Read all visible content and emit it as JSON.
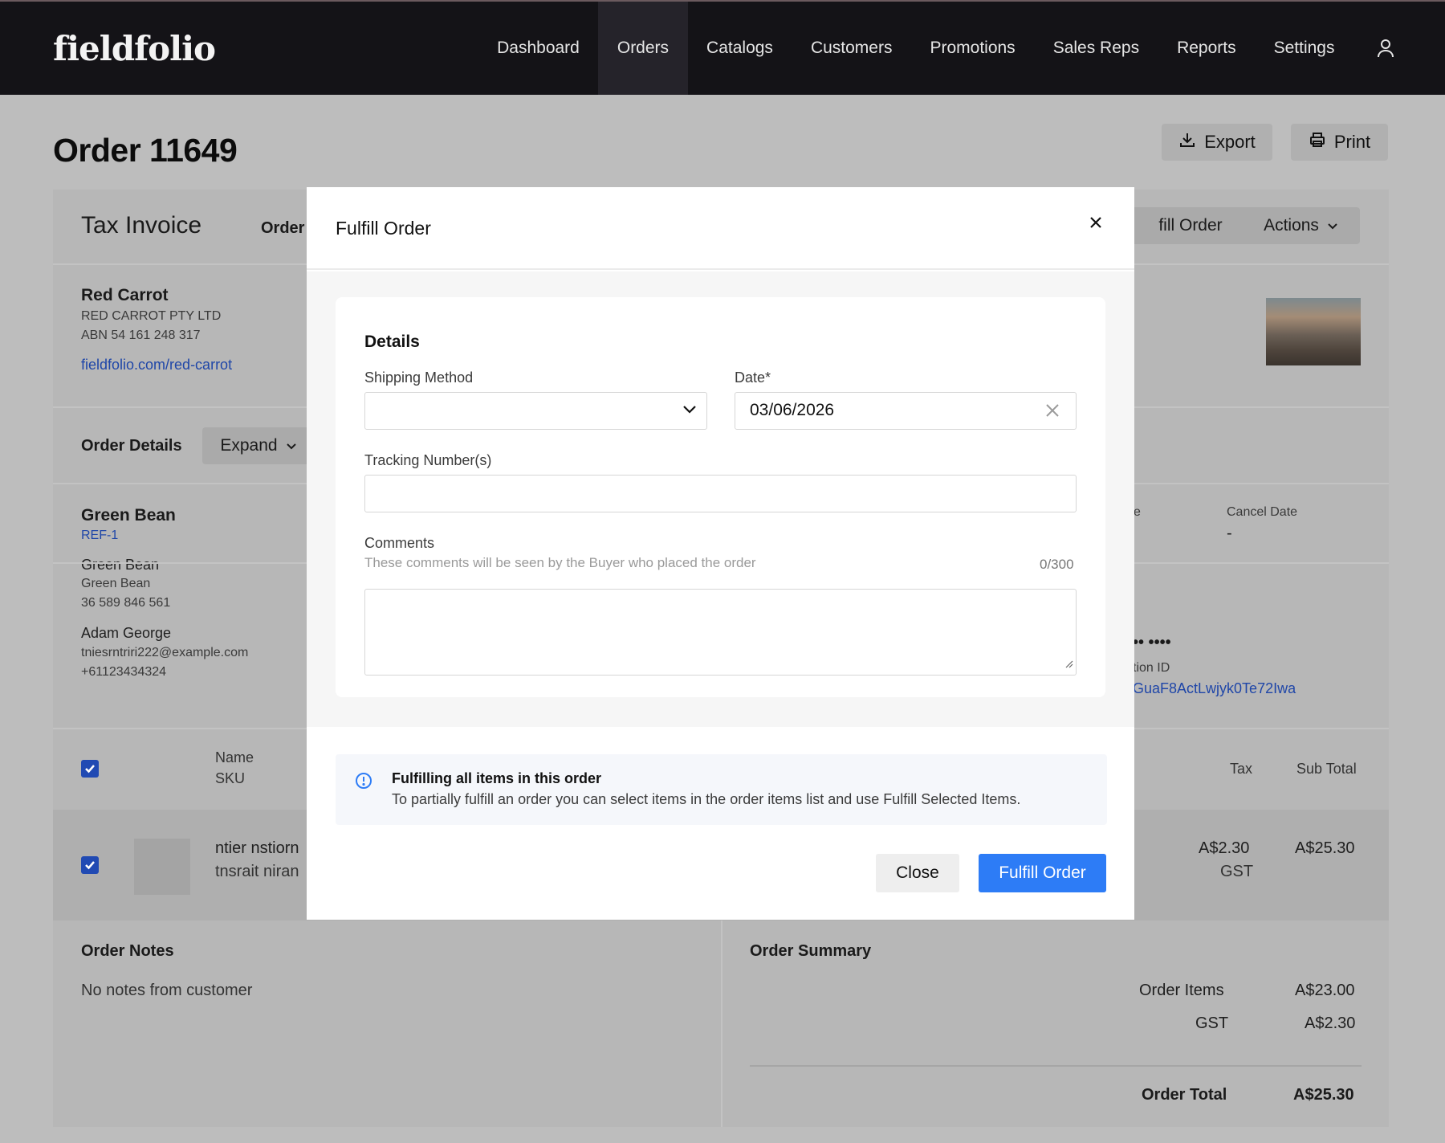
{
  "brand": {
    "logo": "fieldfolio"
  },
  "nav": {
    "items": [
      "Dashboard",
      "Orders",
      "Catalogs",
      "Customers",
      "Promotions",
      "Sales Reps",
      "Reports",
      "Settings"
    ],
    "active": "Orders",
    "user_icon": "user-icon"
  },
  "page": {
    "title": "Order 11649",
    "export_label": "Export",
    "print_label": "Print"
  },
  "invoice": {
    "title": "Tax Invoice",
    "order_tab": "Order",
    "fulfill_label": "fill Order",
    "actions_label": "Actions",
    "seller": {
      "name": "Red Carrot",
      "legal_name": "RED CARROT PTY LTD",
      "abn": "ABN 54 161 248 317",
      "link": "fieldfolio.com/red-carrot"
    },
    "order_details_label": "Order Details",
    "expand_label": "Expand",
    "buyer": {
      "name": "Green Bean",
      "ref": "REF-1",
      "company": "Green Bean",
      "company_sub": "Green Bean",
      "abn": "36 589 846 561",
      "contact": "Adam George",
      "email": "tniesrntriri222@example.com",
      "phone": "+61123434324"
    },
    "partial_date_label": "e",
    "cancel_date_label": "Cancel Date",
    "cancel_date_value": "-",
    "masked_card": "•• ••••",
    "transaction_label": "tion ID",
    "transaction_value": "GuaF8ActLwjyk0Te72Iwa",
    "table": {
      "name_header": "Name",
      "sku_header": "SKU",
      "tax_header": "Tax",
      "subtotal_header": "Sub Total",
      "row": {
        "name": "ntier nstiorn",
        "sku": "tnsrait niran",
        "tax": "A$2.30",
        "tax_type": "GST",
        "subtotal": "A$25.30"
      }
    },
    "notes": {
      "title": "Order Notes",
      "text": "No notes from customer"
    },
    "summary": {
      "title": "Order Summary",
      "items_label": "Order Items",
      "items_value": "A$23.00",
      "gst_label": "GST",
      "gst_value": "A$2.30",
      "total_label": "Order Total",
      "total_value": "A$25.30"
    }
  },
  "modal": {
    "title": "Fulfill Order",
    "section_title": "Details",
    "shipping_label": "Shipping Method",
    "shipping_value": "",
    "date_label": "Date*",
    "date_value": "03/06/2026",
    "tracking_label": "Tracking Number(s)",
    "tracking_value": "",
    "comments_label": "Comments",
    "comments_hint": "These comments will be seen by the Buyer who placed the order",
    "comments_count": "0/300",
    "info_title": "Fulfilling all items in this order",
    "info_text": "To partially fulfill an order you can select items in the order items list and use Fulfill Selected Items.",
    "close_label": "Close",
    "fulfill_label": "Fulfill Order"
  },
  "colors": {
    "nav_bg": "#141317",
    "primary": "#2d7cf6",
    "overlay": "#bdbdbd"
  }
}
